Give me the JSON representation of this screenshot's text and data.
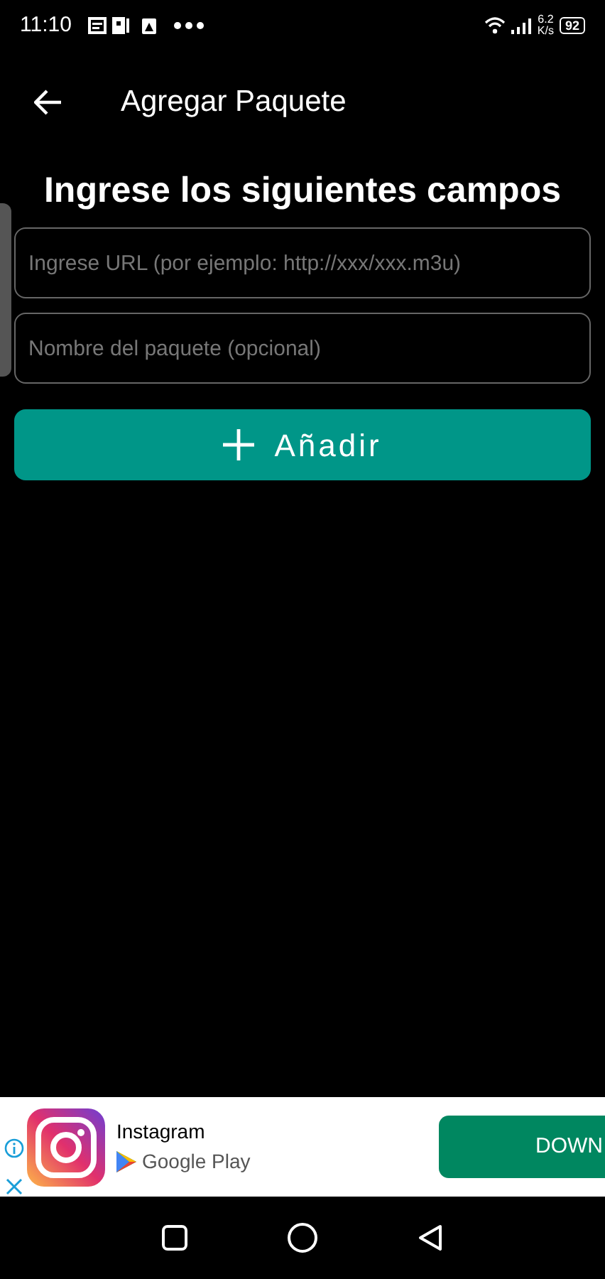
{
  "status_bar": {
    "time": "11:10",
    "speed_value": "6.2",
    "speed_unit": "K/s",
    "battery": "92"
  },
  "app_bar": {
    "title": "Agregar Paquete"
  },
  "form": {
    "heading": "Ingrese los siguientes campos",
    "fields": [
      {
        "placeholder": "Ingrese URL (por ejemplo: http://xxx/xxx.m3u)"
      },
      {
        "placeholder": "Nombre del paquete (opcional)"
      }
    ],
    "submit": {
      "label": "Añadir"
    }
  },
  "ad": {
    "app_name": "Instagram",
    "store": "Google Play",
    "button": "DOWN"
  }
}
